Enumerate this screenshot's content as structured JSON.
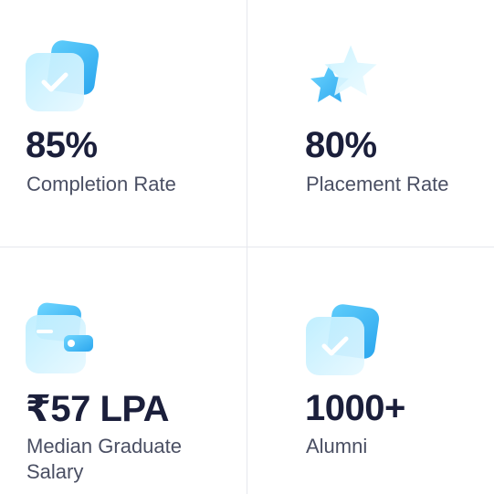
{
  "stats": [
    {
      "value": "85%",
      "label": "Completion Rate",
      "icon": "check-card-icon"
    },
    {
      "value": "80%",
      "label": "Placement Rate",
      "icon": "stars-icon"
    },
    {
      "value": "₹57 LPA",
      "label": "Median Graduate Salary",
      "icon": "wallet-icon"
    },
    {
      "value": "1000+",
      "label": "Alumni",
      "icon": "check-card-icon"
    }
  ],
  "colors": {
    "accent_light": "#8fe0ff",
    "accent": "#35b6f2",
    "text": "#1b1f3b",
    "muted": "#4a4f63",
    "divider": "#e6e8ee"
  }
}
